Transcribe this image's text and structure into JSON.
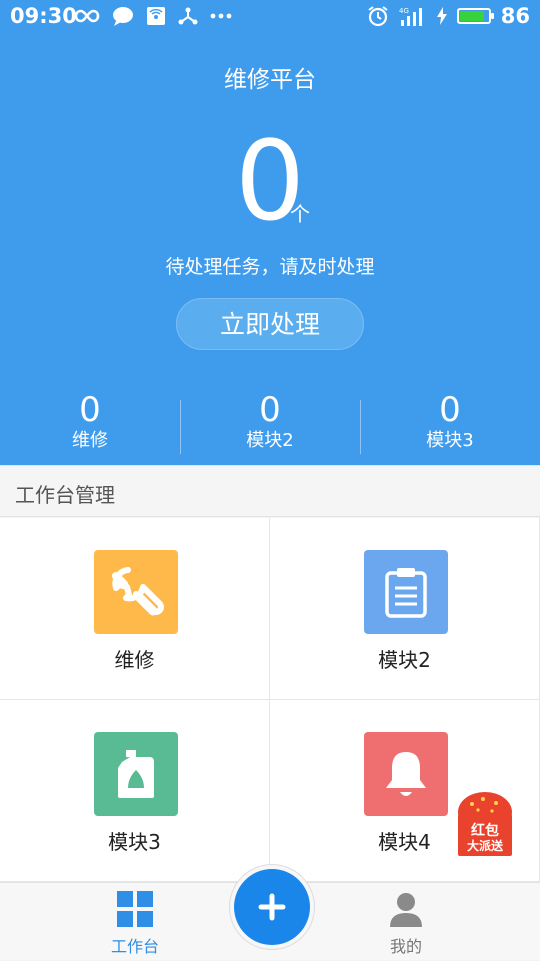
{
  "status_bar": {
    "time": "09:30",
    "battery": "86",
    "network": "4G"
  },
  "hero": {
    "title": "维修平台",
    "count": "0",
    "count_unit": "个",
    "description": "待处理任务，请及时处理",
    "action_label": "立即处理",
    "stats": [
      {
        "value": "0",
        "label": "维修"
      },
      {
        "value": "0",
        "label": "模块2"
      },
      {
        "value": "0",
        "label": "模块3"
      }
    ]
  },
  "section": {
    "title": "工作台管理"
  },
  "modules": [
    {
      "label": "维修",
      "icon": "wrench-icon",
      "color": "#ffb94a"
    },
    {
      "label": "模块2",
      "icon": "clipboard-icon",
      "color": "#6ba7ee"
    },
    {
      "label": "模块3",
      "icon": "oil-bottle-icon",
      "color": "#58bb93"
    },
    {
      "label": "模块4",
      "icon": "bell-icon",
      "color": "#ef6f70"
    }
  ],
  "promo": {
    "line1": "红包",
    "line2": "大派送"
  },
  "tabbar": {
    "items": [
      {
        "label": "工作台",
        "icon": "grid-icon",
        "active": true
      },
      {
        "label": "我的",
        "icon": "user-icon",
        "active": false
      }
    ],
    "fab_icon": "plus-icon"
  },
  "colors": {
    "primary": "#3f9ced",
    "active_tab": "#2f8ee6",
    "inactive_tab": "#777777"
  }
}
